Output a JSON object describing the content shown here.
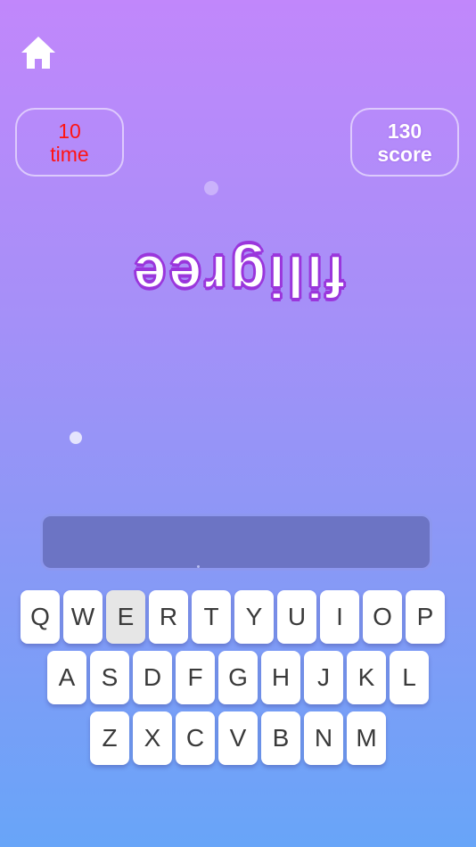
{
  "header": {
    "home_icon": "home-icon"
  },
  "stats": {
    "time": {
      "value": "10",
      "label": "time",
      "color": "#ff1414"
    },
    "score": {
      "value": "130",
      "label": "score",
      "color": "#ffffff"
    }
  },
  "puzzle": {
    "scrambled_word": "filigree"
  },
  "answer": {
    "value": ""
  },
  "keyboard": {
    "rows": [
      [
        "Q",
        "W",
        "E",
        "R",
        "T",
        "Y",
        "U",
        "I",
        "O",
        "P"
      ],
      [
        "A",
        "S",
        "D",
        "F",
        "G",
        "H",
        "J",
        "K",
        "L"
      ],
      [
        "Z",
        "X",
        "C",
        "V",
        "B",
        "N",
        "M"
      ]
    ],
    "pressed_key": "E"
  }
}
